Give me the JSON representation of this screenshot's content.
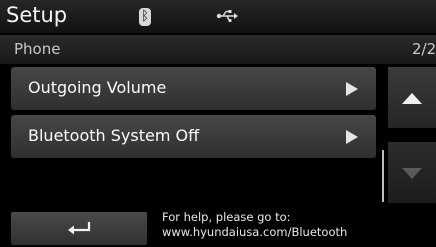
{
  "header": {
    "title": "Setup",
    "bluetooth_glyph": "ᛒ"
  },
  "subheader": {
    "title": "Phone",
    "page_indicator": "2/2"
  },
  "menu": {
    "items": [
      {
        "label": "Outgoing Volume"
      },
      {
        "label": "Bluetooth System Off"
      }
    ]
  },
  "footer": {
    "help_line1": "For help, please go to:",
    "help_line2": "www.hyundaiusa.com/Bluetooth"
  },
  "icons": {
    "status": [
      "bluetooth-icon",
      "usb-icon"
    ],
    "buttons": [
      "back-arrow-icon",
      "scroll-up-icon",
      "scroll-down-icon",
      "chevron-right-icon"
    ]
  }
}
